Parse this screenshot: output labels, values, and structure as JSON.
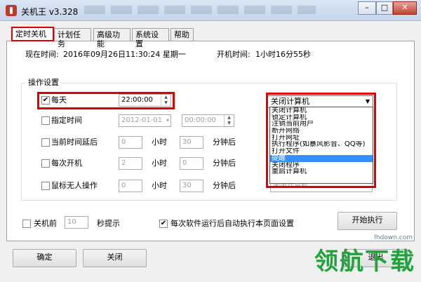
{
  "window": {
    "title": "关机王 v3.328",
    "controls": {
      "minimize": "–",
      "maximize": "□",
      "close": "✕"
    }
  },
  "tabs": [
    {
      "label": "定时关机",
      "active": true
    },
    {
      "label": "计划任务"
    },
    {
      "label": "高级功能"
    },
    {
      "label": "系统设置"
    },
    {
      "label": "帮助"
    }
  ],
  "status": {
    "current_time_label": "现在时间:",
    "current_time_value": "2016年09月26日11:30:24 星期一",
    "uptime_label": "开机时间:",
    "uptime_value": "1小时16分55秒"
  },
  "ops": {
    "group_title": "操作设置",
    "daily": {
      "label": "每天",
      "checked": true,
      "time": "22:00:00"
    },
    "specific": {
      "label": "指定时间",
      "date": "2012-01-01",
      "time": "00:00:00"
    },
    "delay": {
      "label": "当前时间延后",
      "hours": "0",
      "hours_unit": "小时",
      "minutes": "30",
      "minutes_unit": "分钟后"
    },
    "each_boot": {
      "label": "每次开机",
      "hours": "2",
      "hours_unit": "小时",
      "minutes": "0",
      "minutes_unit": "分钟后"
    },
    "idle": {
      "label": "鼠标无人操作",
      "hours": "0",
      "hours_unit": "小时",
      "minutes": "30",
      "minutes_unit": "分钟后"
    }
  },
  "action_select": {
    "selected": "关闭计算机",
    "options": [
      "关闭计算机",
      "锁定计算机",
      "注销当前用户",
      "断开网络",
      "打开网址",
      "执行程序(如暴风影音、QQ等)",
      "打开文件",
      "提醒",
      "关闭程序",
      "重启计算机"
    ],
    "highlighted_index": 7,
    "highlighted_label": "提醒",
    "residual": "关闭计算机"
  },
  "bottom": {
    "pre_shutdown_label": "关机前",
    "pre_shutdown_value": "10",
    "pre_shutdown_unit": "秒提示",
    "auto_exec_label": "每次软件运行后自动执行本页面设置",
    "auto_exec_checked": true,
    "start_button": "开始执行"
  },
  "footer": {
    "ok_button": "确定",
    "close_button": "关闭",
    "exit_button": "退出"
  },
  "watermark": {
    "text": "领航下载",
    "url": "lhdown.com"
  },
  "colors": {
    "highlight_red": "#e00000",
    "selection_blue": "#3390ff",
    "watermark_green": "#1fa33a"
  }
}
